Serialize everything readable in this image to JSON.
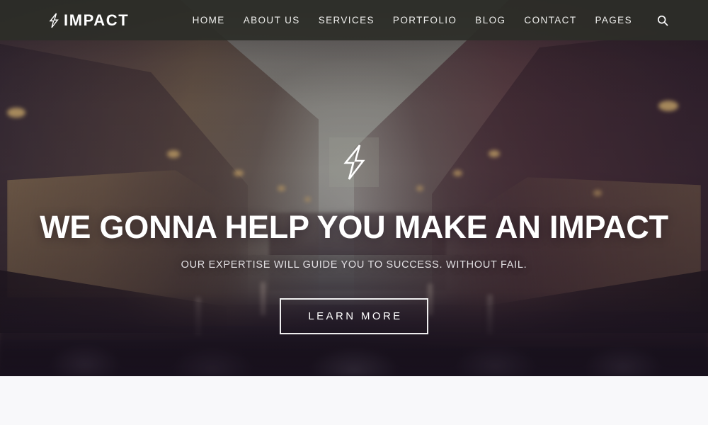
{
  "site": {
    "brand_name": "IMPACT",
    "brand_icon": "lightning-bolt-icon"
  },
  "navbar": {
    "background_color": "#2c2e28",
    "text_color": "#f0f0ee",
    "items": [
      {
        "label": "HOME"
      },
      {
        "label": "ABOUT US"
      },
      {
        "label": "SERVICES"
      },
      {
        "label": "PORTFOLIO"
      },
      {
        "label": "BLOG"
      },
      {
        "label": "CONTACT"
      },
      {
        "label": "PAGES"
      }
    ],
    "search_icon": "search-icon"
  },
  "hero": {
    "badge_icon": "lightning-bolt-icon",
    "title": "WE GONNA HELP YOU MAKE AN IMPACT",
    "subtitle": "OUR EXPERTISE WILL GUIDE YOU TO SUCCESS. WITHOUT FAIL.",
    "cta_label": "LEARN MORE",
    "title_color": "#ffffff",
    "subtitle_color": "#e2e0e3",
    "overlay_tint": "#3a283e",
    "background_description": "city canal at dusk"
  },
  "below_fold": {
    "background_color": "#f8f8fa"
  }
}
